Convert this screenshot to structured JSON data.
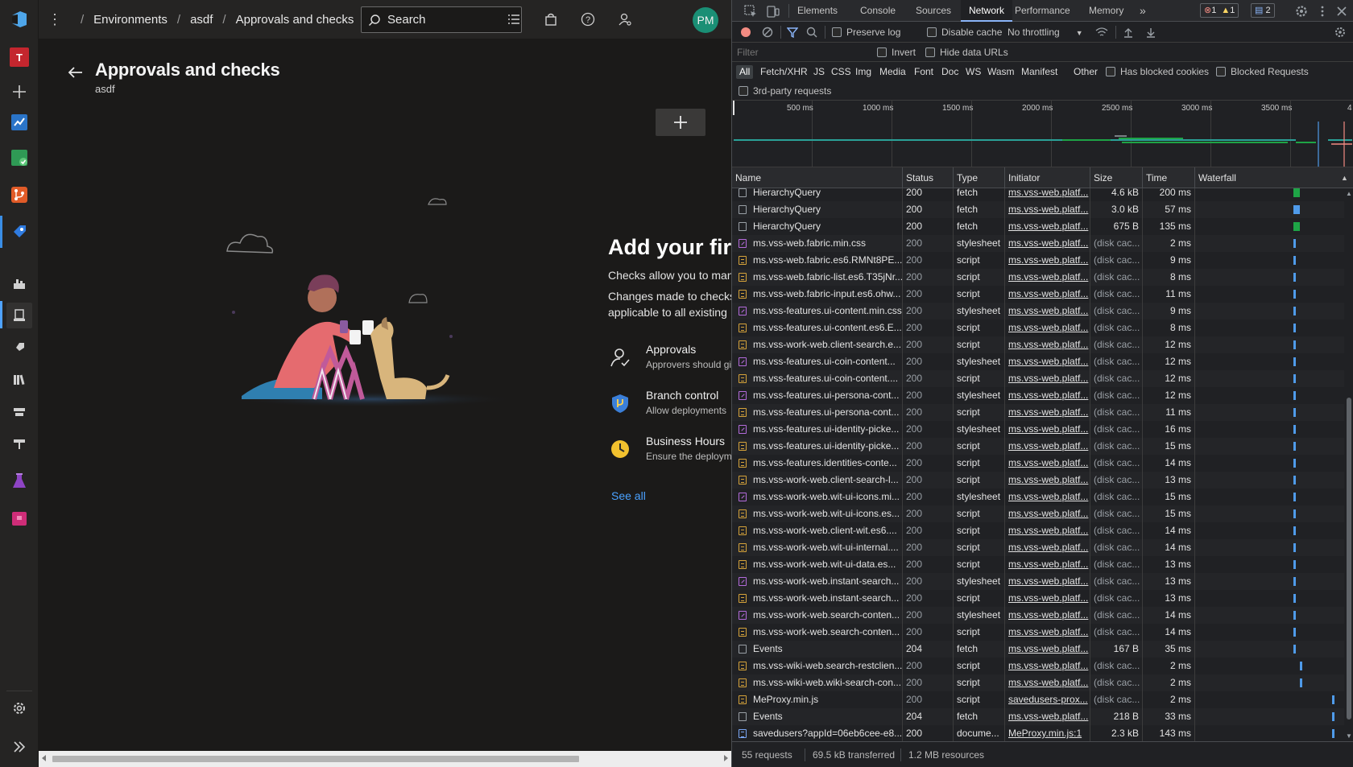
{
  "ado": {
    "breadcrumb": [
      "Environments",
      "asdf",
      "Approvals and checks"
    ],
    "search_placeholder": "Search",
    "avatar_initials": "PM",
    "org_initial": "T",
    "title": "Approvals and checks",
    "subtitle": "asdf",
    "empty_title": "Add your firs",
    "empty_desc_1": "Checks allow you to man",
    "empty_desc_2": "Changes made to checks",
    "empty_desc_3": "applicable to all existing",
    "checks": [
      {
        "title": "Approvals",
        "desc": "Approvers should gi",
        "icon": "person-check-icon"
      },
      {
        "title": "Branch control",
        "desc": "Allow deployments",
        "icon": "shield-branch-icon"
      },
      {
        "title": "Business Hours",
        "desc": "Ensure the deploym",
        "icon": "clock-icon"
      }
    ],
    "see_all": "See all",
    "colors": {
      "accent": "#4aa1ff",
      "avatar": "#1a8f75",
      "org": "#c4262e"
    }
  },
  "devtools": {
    "tabs": [
      "Elements",
      "Console",
      "Sources",
      "Network",
      "Performance",
      "Memory"
    ],
    "active_tab": "Network",
    "badges": {
      "errors": "1",
      "warnings": "1",
      "messages": "2"
    },
    "toolbar": {
      "preserve_log": "Preserve log",
      "disable_cache": "Disable cache",
      "throttling": "No throttling"
    },
    "filter_placeholder": "Filter",
    "invert": "Invert",
    "hide_data_urls": "Hide data URLs",
    "types": [
      "All",
      "Fetch/XHR",
      "JS",
      "CSS",
      "Img",
      "Media",
      "Font",
      "Doc",
      "WS",
      "Wasm",
      "Manifest",
      "Other"
    ],
    "has_blocked_cookies": "Has blocked cookies",
    "blocked_requests": "Blocked Requests",
    "third_party": "3rd-party requests",
    "timeline_ticks": [
      "500 ms",
      "1000 ms",
      "1500 ms",
      "2000 ms",
      "2500 ms",
      "3000 ms",
      "3500 ms",
      "4"
    ],
    "columns": [
      "Name",
      "Status",
      "Type",
      "Initiator",
      "Size",
      "Time",
      "Waterfall"
    ],
    "rows": [
      {
        "name": "HierarchyQuery",
        "status": "200",
        "type": "fetch",
        "initiator": "ms.vss-web.platf...",
        "size": "4.6 kB",
        "time": "200 ms",
        "kind": "fetch"
      },
      {
        "name": "HierarchyQuery",
        "status": "200",
        "type": "fetch",
        "initiator": "ms.vss-web.platf...",
        "size": "3.0 kB",
        "time": "57 ms",
        "kind": "fetch"
      },
      {
        "name": "HierarchyQuery",
        "status": "200",
        "type": "fetch",
        "initiator": "ms.vss-web.platf...",
        "size": "675 B",
        "time": "135 ms",
        "kind": "fetch"
      },
      {
        "name": "ms.vss-web.fabric.min.css",
        "status": "200",
        "type": "stylesheet",
        "initiator": "ms.vss-web.platf...",
        "size": "(disk cac...",
        "time": "2 ms",
        "kind": "stylesheet"
      },
      {
        "name": "ms.vss-web.fabric.es6.RMNt8PE...",
        "status": "200",
        "type": "script",
        "initiator": "ms.vss-web.platf...",
        "size": "(disk cac...",
        "time": "9 ms",
        "kind": "script"
      },
      {
        "name": "ms.vss-web.fabric-list.es6.T35jNr...",
        "status": "200",
        "type": "script",
        "initiator": "ms.vss-web.platf...",
        "size": "(disk cac...",
        "time": "8 ms",
        "kind": "script"
      },
      {
        "name": "ms.vss-web.fabric-input.es6.ohw...",
        "status": "200",
        "type": "script",
        "initiator": "ms.vss-web.platf...",
        "size": "(disk cac...",
        "time": "11 ms",
        "kind": "script"
      },
      {
        "name": "ms.vss-features.ui-content.min.css",
        "status": "200",
        "type": "stylesheet",
        "initiator": "ms.vss-web.platf...",
        "size": "(disk cac...",
        "time": "9 ms",
        "kind": "stylesheet"
      },
      {
        "name": "ms.vss-features.ui-content.es6.E...",
        "status": "200",
        "type": "script",
        "initiator": "ms.vss-web.platf...",
        "size": "(disk cac...",
        "time": "8 ms",
        "kind": "script"
      },
      {
        "name": "ms.vss-work-web.client-search.e...",
        "status": "200",
        "type": "script",
        "initiator": "ms.vss-web.platf...",
        "size": "(disk cac...",
        "time": "12 ms",
        "kind": "script"
      },
      {
        "name": "ms.vss-features.ui-coin-content...",
        "status": "200",
        "type": "stylesheet",
        "initiator": "ms.vss-web.platf...",
        "size": "(disk cac...",
        "time": "12 ms",
        "kind": "stylesheet"
      },
      {
        "name": "ms.vss-features.ui-coin-content....",
        "status": "200",
        "type": "script",
        "initiator": "ms.vss-web.platf...",
        "size": "(disk cac...",
        "time": "12 ms",
        "kind": "script"
      },
      {
        "name": "ms.vss-features.ui-persona-cont...",
        "status": "200",
        "type": "stylesheet",
        "initiator": "ms.vss-web.platf...",
        "size": "(disk cac...",
        "time": "12 ms",
        "kind": "stylesheet"
      },
      {
        "name": "ms.vss-features.ui-persona-cont...",
        "status": "200",
        "type": "script",
        "initiator": "ms.vss-web.platf...",
        "size": "(disk cac...",
        "time": "11 ms",
        "kind": "script"
      },
      {
        "name": "ms.vss-features.ui-identity-picke...",
        "status": "200",
        "type": "stylesheet",
        "initiator": "ms.vss-web.platf...",
        "size": "(disk cac...",
        "time": "16 ms",
        "kind": "stylesheet"
      },
      {
        "name": "ms.vss-features.ui-identity-picke...",
        "status": "200",
        "type": "script",
        "initiator": "ms.vss-web.platf...",
        "size": "(disk cac...",
        "time": "15 ms",
        "kind": "script"
      },
      {
        "name": "ms.vss-features.identities-conte...",
        "status": "200",
        "type": "script",
        "initiator": "ms.vss-web.platf...",
        "size": "(disk cac...",
        "time": "14 ms",
        "kind": "script"
      },
      {
        "name": "ms.vss-work-web.client-search-l...",
        "status": "200",
        "type": "script",
        "initiator": "ms.vss-web.platf...",
        "size": "(disk cac...",
        "time": "13 ms",
        "kind": "script"
      },
      {
        "name": "ms.vss-work-web.wit-ui-icons.mi...",
        "status": "200",
        "type": "stylesheet",
        "initiator": "ms.vss-web.platf...",
        "size": "(disk cac...",
        "time": "15 ms",
        "kind": "stylesheet"
      },
      {
        "name": "ms.vss-work-web.wit-ui-icons.es...",
        "status": "200",
        "type": "script",
        "initiator": "ms.vss-web.platf...",
        "size": "(disk cac...",
        "time": "15 ms",
        "kind": "script"
      },
      {
        "name": "ms.vss-work-web.client-wit.es6....",
        "status": "200",
        "type": "script",
        "initiator": "ms.vss-web.platf...",
        "size": "(disk cac...",
        "time": "14 ms",
        "kind": "script"
      },
      {
        "name": "ms.vss-work-web.wit-ui-internal....",
        "status": "200",
        "type": "script",
        "initiator": "ms.vss-web.platf...",
        "size": "(disk cac...",
        "time": "14 ms",
        "kind": "script"
      },
      {
        "name": "ms.vss-work-web.wit-ui-data.es...",
        "status": "200",
        "type": "script",
        "initiator": "ms.vss-web.platf...",
        "size": "(disk cac...",
        "time": "13 ms",
        "kind": "script"
      },
      {
        "name": "ms.vss-work-web.instant-search...",
        "status": "200",
        "type": "stylesheet",
        "initiator": "ms.vss-web.platf...",
        "size": "(disk cac...",
        "time": "13 ms",
        "kind": "stylesheet"
      },
      {
        "name": "ms.vss-work-web.instant-search...",
        "status": "200",
        "type": "script",
        "initiator": "ms.vss-web.platf...",
        "size": "(disk cac...",
        "time": "13 ms",
        "kind": "script"
      },
      {
        "name": "ms.vss-work-web.search-conten...",
        "status": "200",
        "type": "stylesheet",
        "initiator": "ms.vss-web.platf...",
        "size": "(disk cac...",
        "time": "14 ms",
        "kind": "stylesheet"
      },
      {
        "name": "ms.vss-work-web.search-conten...",
        "status": "200",
        "type": "script",
        "initiator": "ms.vss-web.platf...",
        "size": "(disk cac...",
        "time": "14 ms",
        "kind": "script"
      },
      {
        "name": "Events",
        "status": "204",
        "type": "fetch",
        "initiator": "ms.vss-web.platf...",
        "size": "167 B",
        "time": "35 ms",
        "kind": "fetch"
      },
      {
        "name": "ms.vss-wiki-web.search-restclien...",
        "status": "200",
        "type": "script",
        "initiator": "ms.vss-web.platf...",
        "size": "(disk cac...",
        "time": "2 ms",
        "kind": "script"
      },
      {
        "name": "ms.vss-wiki-web.wiki-search-con...",
        "status": "200",
        "type": "script",
        "initiator": "ms.vss-web.platf...",
        "size": "(disk cac...",
        "time": "2 ms",
        "kind": "script"
      },
      {
        "name": "MeProxy.min.js",
        "status": "200",
        "type": "script",
        "initiator": "savedusers-prox...",
        "size": "(disk cac...",
        "time": "2 ms",
        "kind": "script"
      },
      {
        "name": "Events",
        "status": "204",
        "type": "fetch",
        "initiator": "ms.vss-web.platf...",
        "size": "218 B",
        "time": "33 ms",
        "kind": "fetch"
      },
      {
        "name": "savedusers?appId=06eb6cee-e8...",
        "status": "200",
        "type": "docume...",
        "initiator": "MeProxy.min.js:1",
        "size": "2.3 kB",
        "time": "143 ms",
        "kind": "document"
      }
    ],
    "status": {
      "requests": "55 requests",
      "transferred": "69.5 kB transferred",
      "resources": "1.2 MB resources"
    },
    "colors": {
      "accent": "#8ab4f8",
      "record": "#f28b82",
      "waterfall_green": "#1ea446",
      "waterfall_blue": "#4f9bea"
    }
  }
}
